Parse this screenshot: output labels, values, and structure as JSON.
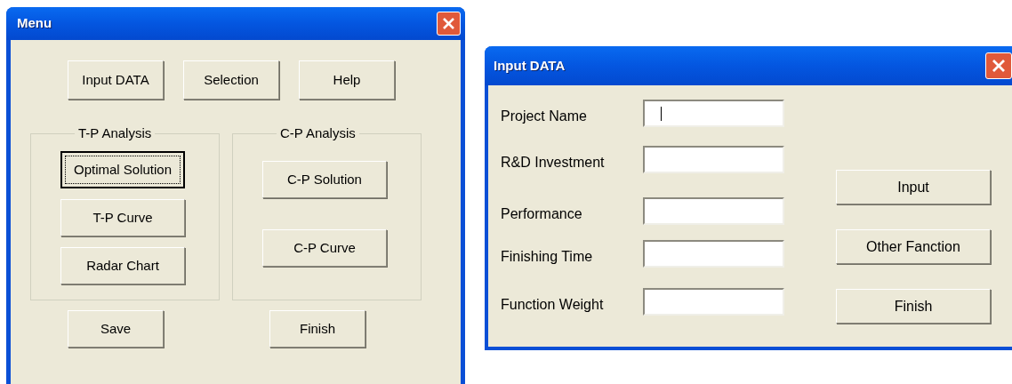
{
  "menu_window": {
    "title": "Menu",
    "top_buttons": [
      {
        "label": "Input DATA",
        "focused": false
      },
      {
        "label": "Selection",
        "focused": false
      },
      {
        "label": "Help",
        "focused": false
      }
    ],
    "groups": [
      {
        "title": "T-P Analysis",
        "buttons": [
          {
            "label": "Optimal Solution",
            "focused": true
          },
          {
            "label": "T-P Curve",
            "focused": false
          },
          {
            "label": "Radar Chart",
            "focused": false
          }
        ]
      },
      {
        "title": "C-P Analysis",
        "buttons": [
          {
            "label": "C-P Solution",
            "focused": false
          },
          {
            "label": "C-P Curve",
            "focused": false
          }
        ]
      }
    ],
    "bottom_buttons": [
      {
        "label": "Save",
        "focused": false
      },
      {
        "label": "Finish",
        "focused": false
      }
    ]
  },
  "input_window": {
    "title": "Input DATA",
    "fields": [
      {
        "label": "Project Name",
        "focused": true
      },
      {
        "label": "R&D Investment",
        "focused": false
      },
      {
        "label": "Performance",
        "focused": false
      },
      {
        "label": "Finishing Time",
        "focused": false
      },
      {
        "label": "Function Weight",
        "focused": false
      }
    ],
    "buttons": [
      {
        "label": "Input",
        "focused": false
      },
      {
        "label": "Other Fanction",
        "focused": false
      },
      {
        "label": "Finish",
        "focused": false
      }
    ]
  }
}
